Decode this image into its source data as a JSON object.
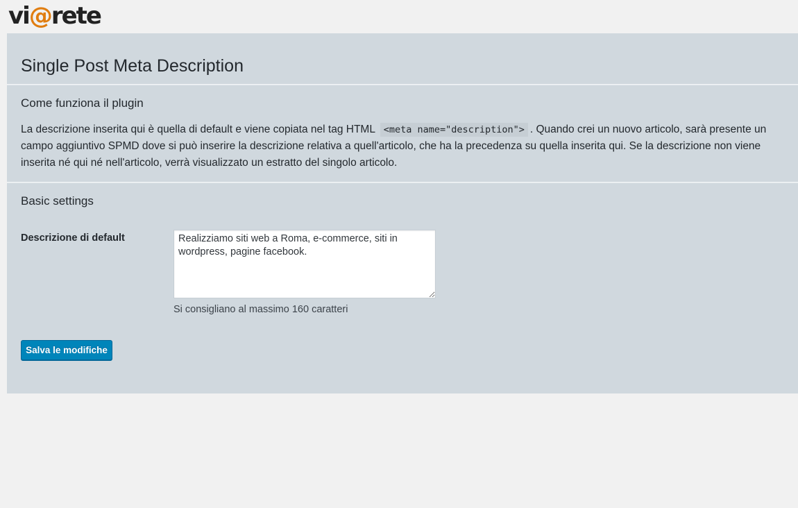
{
  "logo": {
    "part1": "vi",
    "at": "@",
    "part2": "rete"
  },
  "page": {
    "title": "Single Post Meta Description"
  },
  "how_it_works": {
    "title": "Come funziona il plugin",
    "text_before": "La descrizione inserita qui è quella di default e viene copiata nel tag HTML",
    "code": "<meta name=\"description\">",
    "text_after": ". Quando crei un nuovo articolo, sarà presente un campo aggiuntivo SPMD dove si può inserire la descrizione relativa a quell'articolo, che ha la precedenza su quella inserita qui. Se la descrizione non viene inserita né qui né nell'articolo, verrà visualizzato un estratto del singolo articolo."
  },
  "basic_settings": {
    "title": "Basic settings",
    "field_label": "Descrizione di default",
    "field_value": "Realizziamo siti web a Roma, e-commerce, siti in wordpress, pagine facebook.",
    "hint": "Si consigliano al massimo 160 caratteri"
  },
  "actions": {
    "save_label": "Salva le modifiche"
  },
  "colors": {
    "panel_bg": "#d0d8de",
    "page_bg": "#f1f1f1",
    "button_bg": "#0085ba",
    "logo_accent": "#e07d10"
  }
}
